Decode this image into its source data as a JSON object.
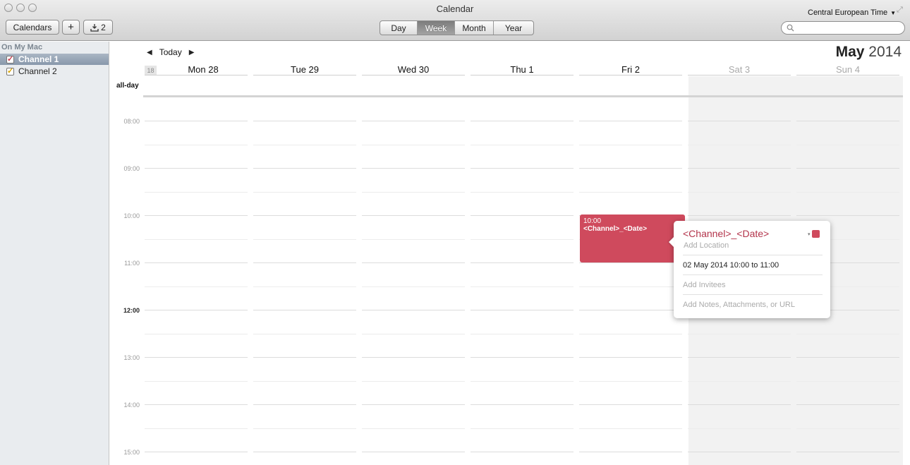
{
  "window": {
    "title": "Calendar",
    "timezone": "Central European Time",
    "timezone_caret": "▼",
    "resize_glyph": "⤢"
  },
  "toolbar": {
    "calendars_label": "Calendars",
    "add_label": "+",
    "inbox_icon": "tray-download-icon",
    "inbox_count": "2",
    "views": [
      "Day",
      "Week",
      "Month",
      "Year"
    ],
    "active_view": "Week",
    "search": {
      "placeholder": "",
      "icon": "magnifier-icon"
    }
  },
  "sidebar": {
    "heading": "On My Mac",
    "items": [
      {
        "label": "Channel 1",
        "checked": true,
        "color": "#c93a4b",
        "selected": true
      },
      {
        "label": "Channel 2",
        "checked": true,
        "color": "#d8a400",
        "selected": false
      }
    ]
  },
  "header": {
    "today_label": "Today",
    "month": "May",
    "year": "2014",
    "week_number": "18",
    "days": [
      {
        "label": "Mon 28",
        "weekend": false
      },
      {
        "label": "Tue 29",
        "weekend": false
      },
      {
        "label": "Wed 30",
        "weekend": false
      },
      {
        "label": "Thu 1",
        "weekend": false
      },
      {
        "label": "Fri 2",
        "weekend": false
      },
      {
        "label": "Sat 3",
        "weekend": true
      },
      {
        "label": "Sun 4",
        "weekend": true
      }
    ],
    "allday_label": "all-day"
  },
  "grid": {
    "hours": [
      "08:00",
      "09:00",
      "10:00",
      "11:00",
      "12:00",
      "13:00",
      "14:00",
      "15:00"
    ],
    "current_hour": "12:00"
  },
  "event": {
    "time": "10:00",
    "title": "<Channel>_<Date>",
    "color": "#cf4a5d"
  },
  "popover": {
    "title": "<Channel>_<Date>",
    "location_placeholder": "Add Location",
    "date_time": "02 May 2014  10:00 to 11:00",
    "invitees_placeholder": "Add Invitees",
    "notes_placeholder": "Add Notes, Attachments, or URL",
    "color_caret": "▾"
  }
}
